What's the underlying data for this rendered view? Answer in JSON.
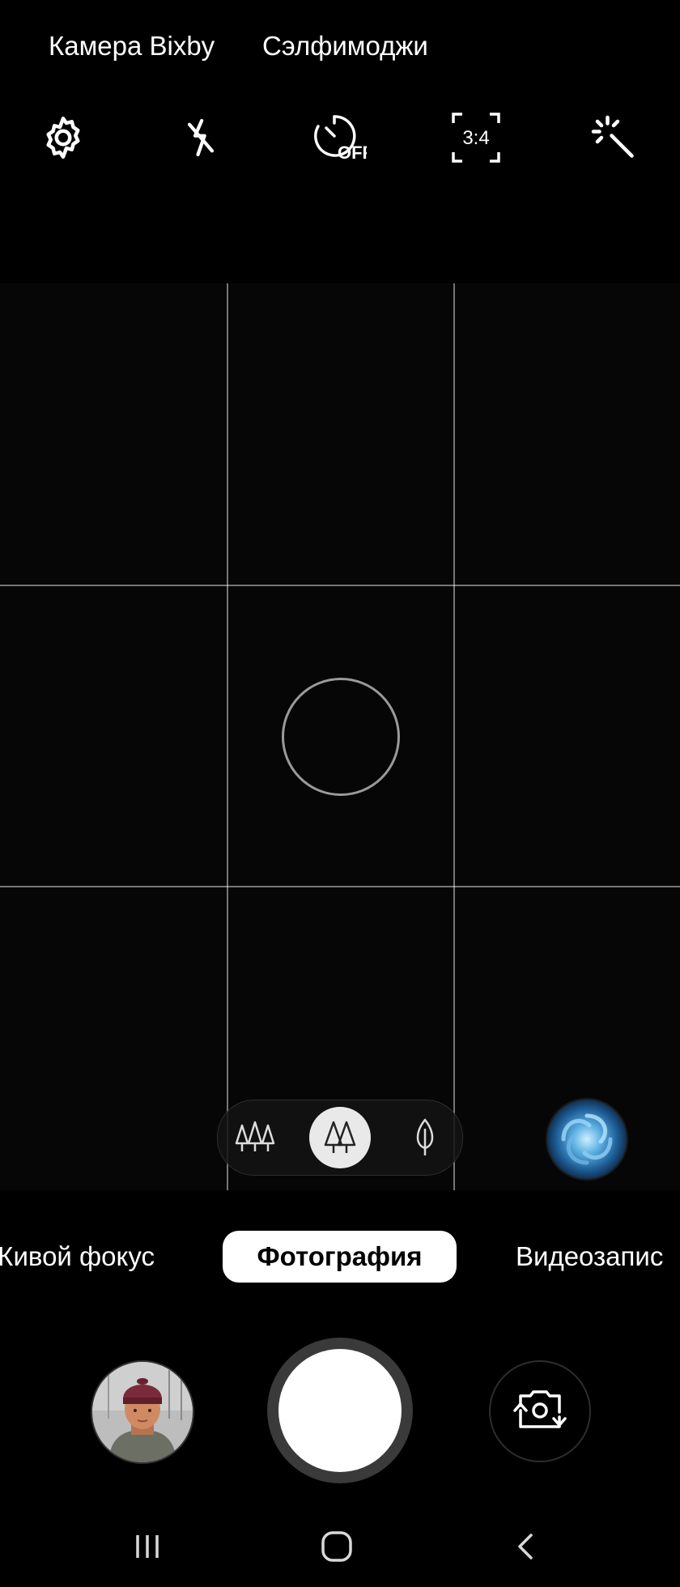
{
  "top_links": {
    "bixby": "Камера Bixby",
    "selfie": "Сэлфимоджи"
  },
  "toolbar": {
    "settings_icon": "gear-icon",
    "flash_icon": "flash-off-icon",
    "timer_icon": "timer-off-icon",
    "timer_label": "OFF",
    "ratio_label": "3:4",
    "filter_icon": "magic-wand-icon"
  },
  "zoom": {
    "options": [
      "wide-angle-icon",
      "normal-icon",
      "telephoto-icon"
    ],
    "selected": "normal-icon"
  },
  "modes": {
    "live_focus": "Живой фокус",
    "photo": "Фотография",
    "video": "Видеозапис",
    "selected": "photo"
  },
  "colors": {
    "background": "#000000",
    "selected_mode_bg": "#ffffff",
    "grid_line": "#8a8a8a"
  }
}
